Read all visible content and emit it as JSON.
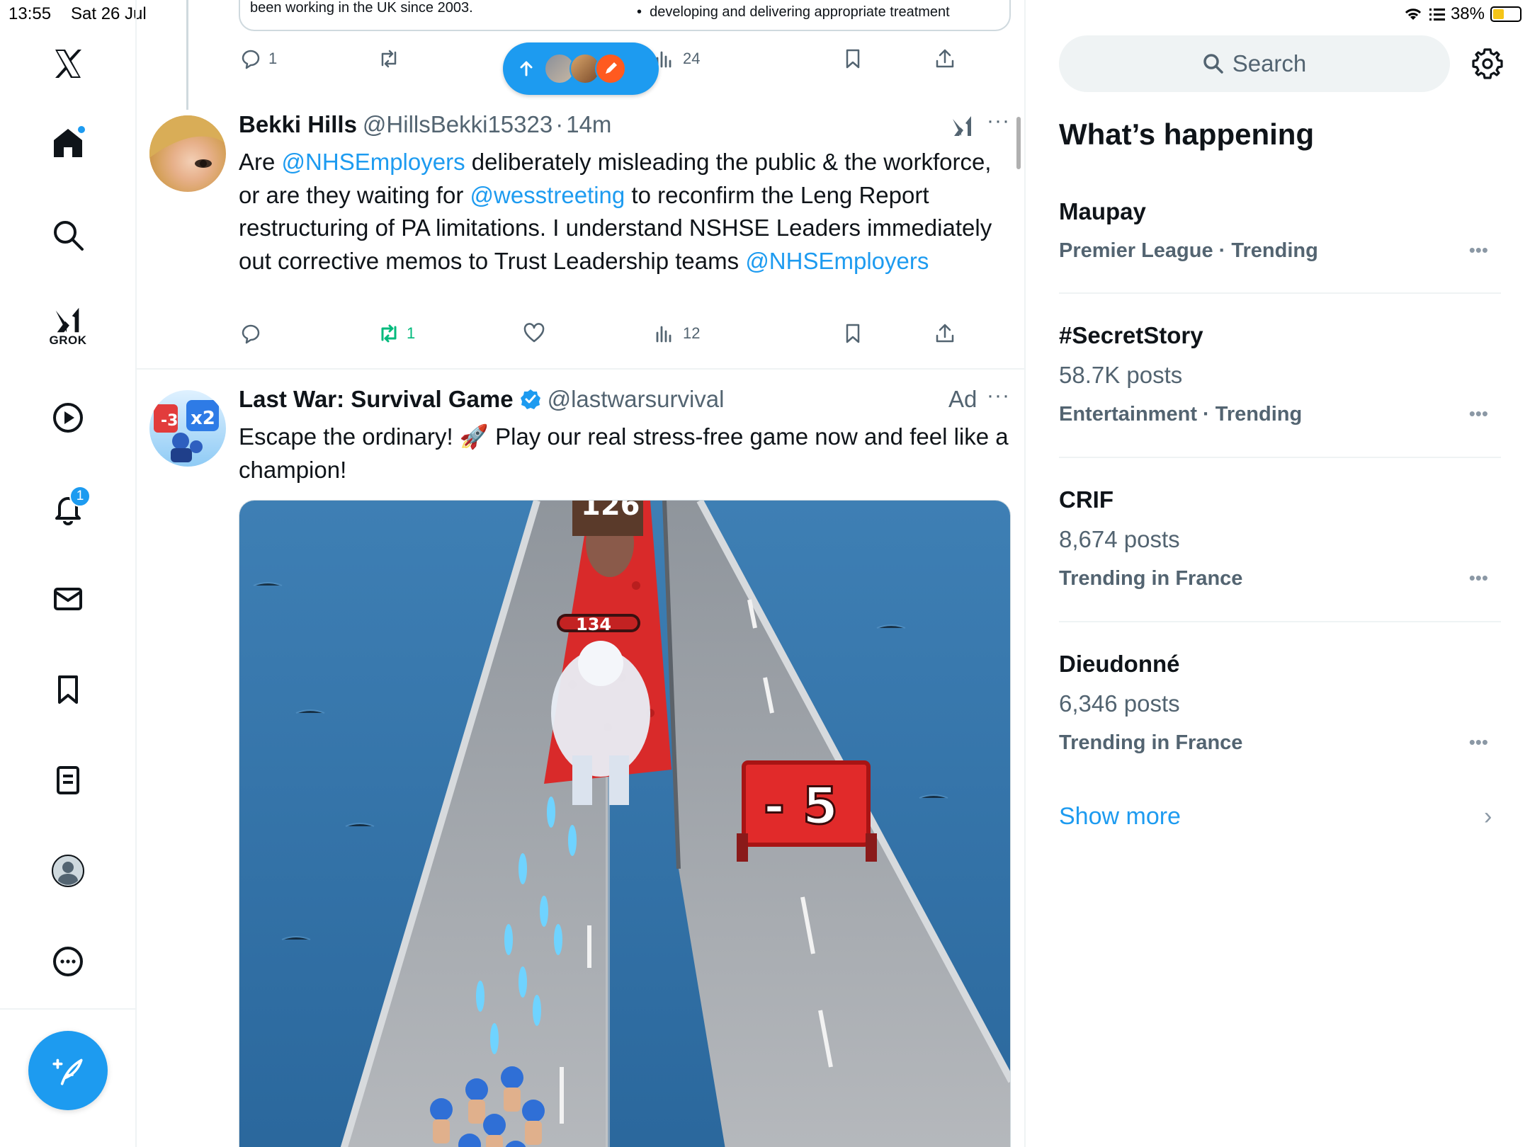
{
  "status_bar": {
    "time": "13:55",
    "date": "Sat 26 Jul",
    "battery": "38%"
  },
  "nav": {
    "logo": "x-logo-icon",
    "home_badge": true,
    "grok_label": "GROK",
    "notifications_count": "1",
    "items": [
      "home-icon",
      "search-icon",
      "grok-icon",
      "video-icon",
      "bell-icon",
      "mail-icon",
      "bookmark-icon",
      "lists-icon",
      "profile-icon",
      "more-icon"
    ]
  },
  "quoted_post": {
    "left_text": "been working in the UK since 2003.",
    "right_text": "developing and delivering appropriate treatment"
  },
  "top_post_actions": {
    "replies": "1",
    "views": "24"
  },
  "posts": [
    {
      "name": "Bekki Hills",
      "handle": "@HillsBekki15323",
      "separator": "·",
      "time": "14m",
      "body": [
        {
          "t": "Are "
        },
        {
          "t": "@NHSEmployers",
          "m": true
        },
        {
          "t": " deliberately misleading the public & the workforce, or are they waiting for "
        },
        {
          "t": "@wesstreeting",
          "m": true
        },
        {
          "t": " to reconfirm the Leng Report restructuring of PA limitations.  I understand NSHSE Leaders immediately out corrective memos to Trust Leadership teams "
        },
        {
          "t": "@NHSEmployers",
          "m": true
        }
      ],
      "reposts": "1",
      "views": "12"
    },
    {
      "name": "Last War: Survival Game",
      "handle": "@lastwarsurvival",
      "ad_label": "Ad",
      "body_text": "Escape the ordinary! 🚀 Play our real stress-free game now and feel like a champion!",
      "media": {
        "counter_top": "126",
        "enemy_count": "134",
        "gate_value": "- 5"
      }
    }
  ],
  "search": {
    "placeholder": "Search"
  },
  "trends_title": "What’s happening",
  "trends": [
    {
      "name": "Maupay",
      "posts": "",
      "meta": "Premier League · Trending"
    },
    {
      "name": "#SecretStory",
      "posts": "58.7K posts",
      "meta": "Entertainment · Trending"
    },
    {
      "name": "CRIF",
      "posts": "8,674 posts",
      "meta": "Trending in France"
    },
    {
      "name": "Dieudonné",
      "posts": "6,346 posts",
      "meta": "Trending in France"
    }
  ],
  "show_more": "Show more",
  "colors": {
    "accent": "#1d9bf0",
    "repost_green": "#00ba7c",
    "secondary_text": "#536471"
  }
}
